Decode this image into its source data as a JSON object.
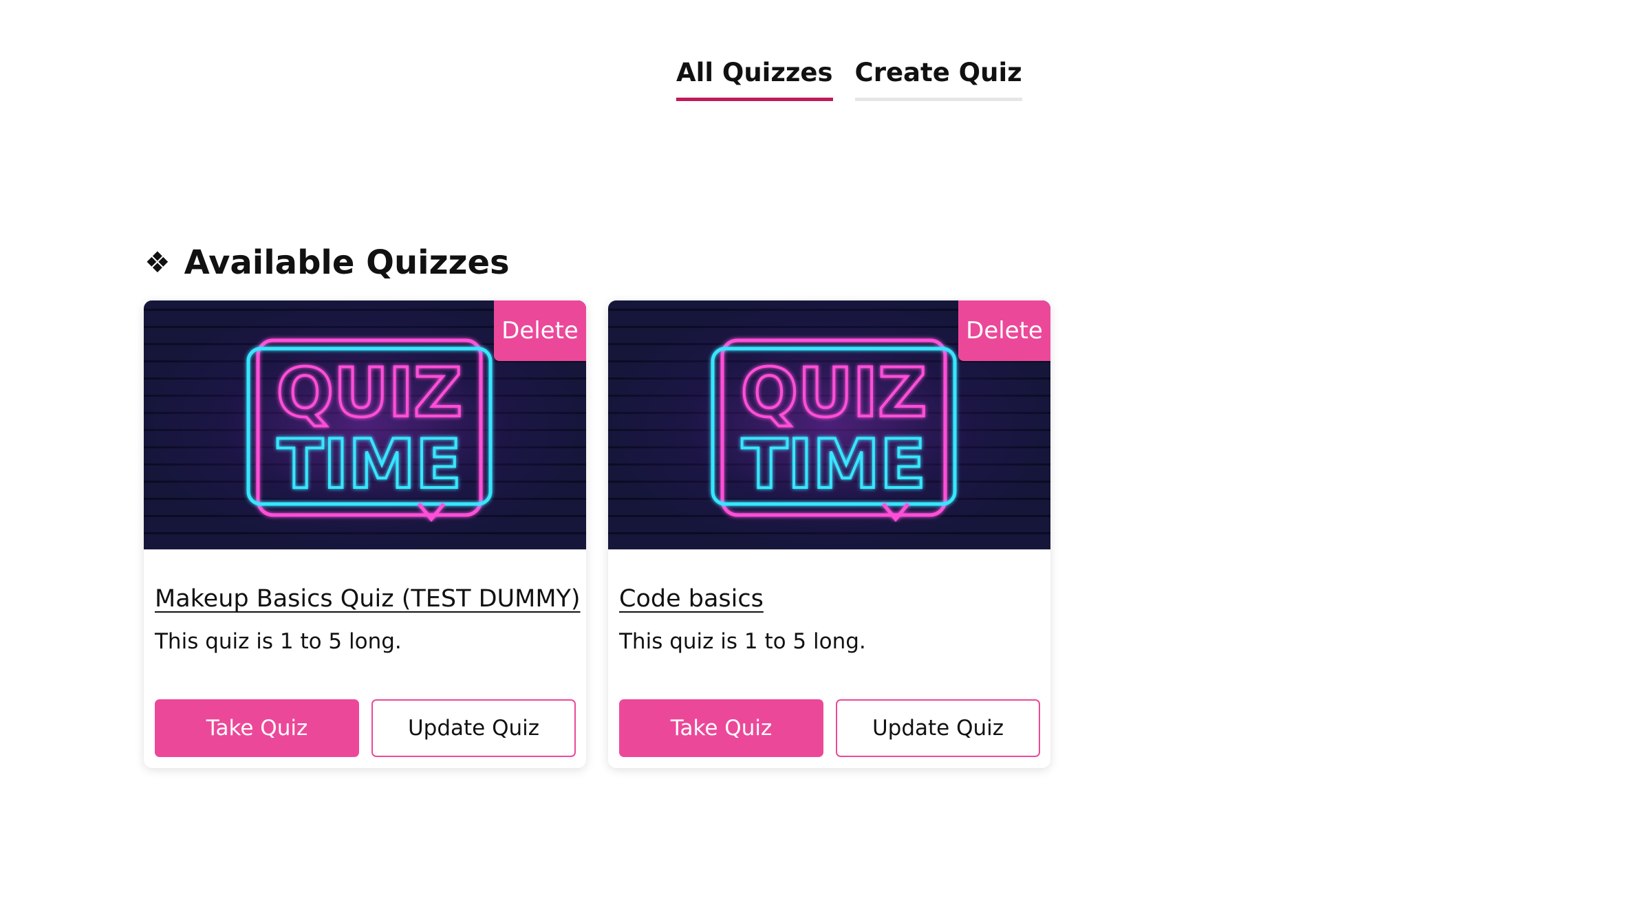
{
  "nav": {
    "items": [
      {
        "label": "All Quizzes",
        "active": true
      },
      {
        "label": "Create Quiz",
        "active": false
      }
    ]
  },
  "section": {
    "icon": "❖",
    "title": "Available Quizzes"
  },
  "quizzes": [
    {
      "title": "Makeup Basics Quiz (TEST DUMMY)",
      "description": "This quiz is 1 to 5 long.",
      "image_text_top": "QUIZ",
      "image_text_bottom": "TIME",
      "delete_label": "Delete",
      "take_label": "Take Quiz",
      "update_label": "Update Quiz"
    },
    {
      "title": "Code basics",
      "description": "This quiz is 1 to 5 long.",
      "image_text_top": "QUIZ",
      "image_text_bottom": "TIME",
      "delete_label": "Delete",
      "take_label": "Take Quiz",
      "update_label": "Update Quiz"
    }
  ],
  "colors": {
    "accent": "#ec4899",
    "nav_active_underline": "#c2185b",
    "neon_pink": "#ff4fd8",
    "neon_cyan": "#39e6ff",
    "image_bg": "#101030"
  }
}
